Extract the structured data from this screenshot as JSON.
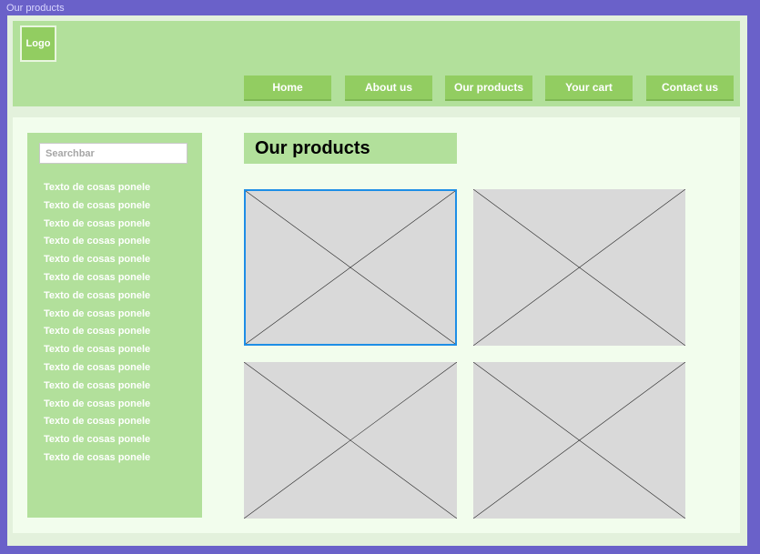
{
  "frame": {
    "label": "Our products"
  },
  "header": {
    "logo": "Logo",
    "nav": [
      "Home",
      "About us",
      "Our products",
      "Your cart",
      "Contact us"
    ]
  },
  "sidebar": {
    "search_placeholder": "Searchbar",
    "items": [
      "Texto de cosas ponele",
      "Texto de cosas ponele",
      "Texto de cosas ponele",
      "Texto de cosas ponele",
      "Texto de cosas ponele",
      "Texto de cosas ponele",
      "Texto de cosas ponele",
      "Texto de cosas ponele",
      "Texto de cosas ponele",
      "Texto de cosas ponele",
      "Texto de cosas ponele",
      "Texto de cosas ponele",
      "Texto de cosas ponele",
      "Texto de cosas ponele",
      "Texto de cosas ponele",
      "Texto de cosas ponele"
    ]
  },
  "main": {
    "title": "Our products"
  },
  "colors": {
    "background": "#6a61c9",
    "header": "#b2e09b",
    "accent": "#92cd61",
    "content": "#f2fded",
    "selection": "#1e8ee6",
    "placeholder": "#d9d9d9"
  }
}
